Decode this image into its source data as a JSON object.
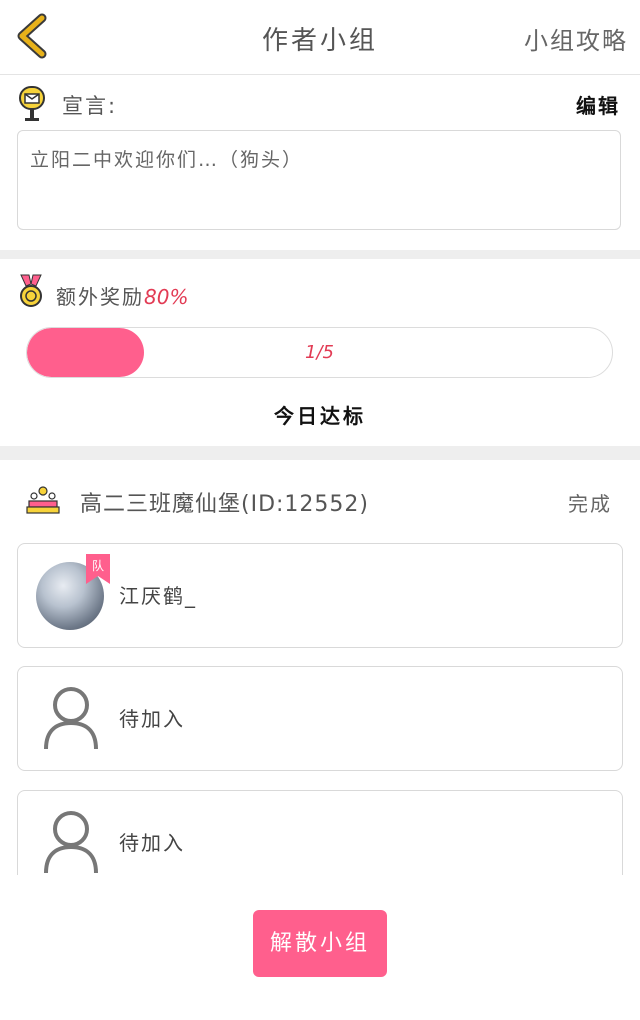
{
  "header": {
    "title": "作者小组",
    "guide_label": "小组攻略"
  },
  "declaration": {
    "label": "宣言:",
    "edit_label": "编辑",
    "text": "立阳二中欢迎你们…（狗头）"
  },
  "reward": {
    "label": "额外奖励",
    "percent": "80%",
    "progress_text": "1/5",
    "progress_fraction": 0.2,
    "goal_label": "今日达标"
  },
  "group": {
    "name": "高二三班魔仙堡(ID:12552)",
    "done_label": "完成",
    "members": [
      {
        "name": "江厌鹤_",
        "badge": "队",
        "status": "leader"
      },
      {
        "name": "待加入",
        "status": "pending"
      },
      {
        "name": "待加入",
        "status": "pending"
      }
    ]
  },
  "footer": {
    "dismiss_label": "解散小组"
  },
  "colors": {
    "accent": "#ff5f8d",
    "highlight": "#e23b54",
    "back_arrow": "#e8b21a"
  }
}
